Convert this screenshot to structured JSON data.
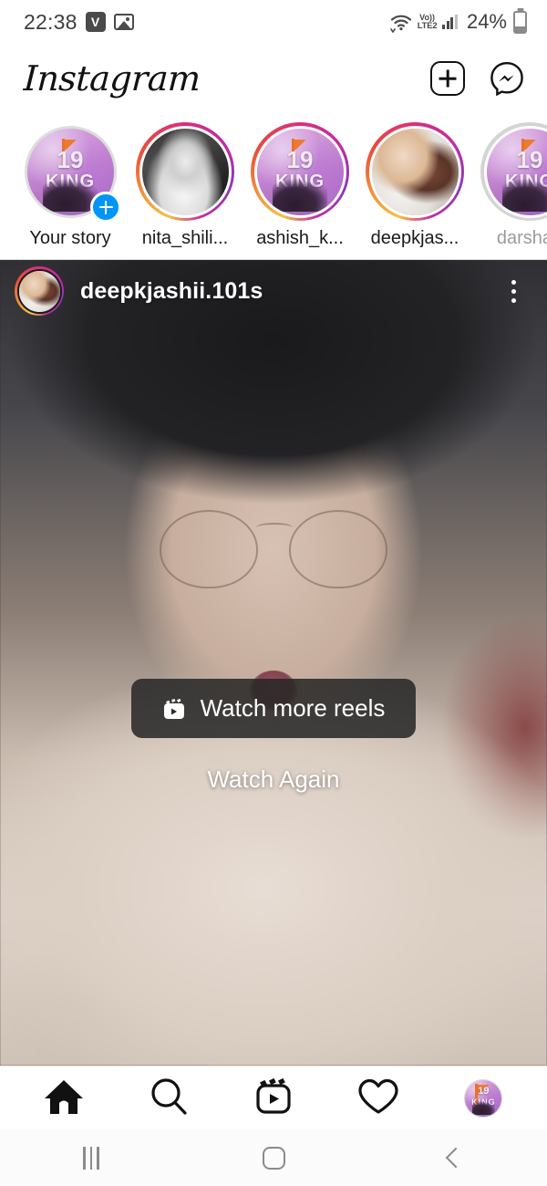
{
  "status_bar": {
    "time": "22:38",
    "app_badge_letter": "V",
    "icons": [
      "v-badge-icon",
      "image-icon",
      "wifi-icon",
      "volte-icon",
      "signal-bars-icon",
      "battery-icon"
    ],
    "network_label_top": "Vo))",
    "network_label_bottom": "LTE2",
    "battery_percent": "24%"
  },
  "header": {
    "logo_text": "Instagram",
    "actions": [
      {
        "name": "new-post-button",
        "icon": "plus-square-icon"
      },
      {
        "name": "messenger-button",
        "icon": "messenger-icon"
      }
    ]
  },
  "stories": [
    {
      "label": "Your story",
      "ring": "none",
      "thumb": "poster",
      "has_add_badge": true,
      "seen": false
    },
    {
      "label": "nita_shili...",
      "ring": "gradient",
      "thumb": "portrait-bw",
      "has_add_badge": false,
      "seen": false
    },
    {
      "label": "ashish_k...",
      "ring": "gradient",
      "thumb": "poster",
      "has_add_badge": false,
      "seen": false
    },
    {
      "label": "deepkjas...",
      "ring": "gradient",
      "thumb": "couple",
      "has_add_badge": false,
      "seen": false
    },
    {
      "label": "darshan",
      "ring": "seen",
      "thumb": "poster",
      "has_add_badge": false,
      "seen": true
    }
  ],
  "post": {
    "username": "deepkjashii.101s",
    "avatar_thumb": "couple",
    "more_menu_icon": "three-dots-vertical-icon",
    "media_type": "video-reel-ended",
    "overlay": {
      "watch_more_reels_label": "Watch more reels",
      "watch_more_reels_icon": "reels-icon",
      "watch_again_label": "Watch Again"
    }
  },
  "bottom_nav": [
    {
      "name": "nav-home",
      "icon": "home-icon",
      "active": true
    },
    {
      "name": "nav-search",
      "icon": "search-icon",
      "active": false
    },
    {
      "name": "nav-reels",
      "icon": "reels-icon",
      "active": false
    },
    {
      "name": "nav-activity",
      "icon": "heart-icon",
      "active": false
    },
    {
      "name": "nav-profile",
      "icon": "profile-avatar-icon",
      "active": false
    }
  ],
  "android_nav": [
    {
      "name": "android-recents-button",
      "icon": "recents-icon"
    },
    {
      "name": "android-home-button",
      "icon": "home-square-icon"
    },
    {
      "name": "android-back-button",
      "icon": "back-chevron-icon"
    }
  ],
  "colors": {
    "accent_blue": "#0095f6",
    "story_gradient_start": "#f5c244",
    "story_gradient_mid": "#d92e7f",
    "story_gradient_end": "#8a3ab9",
    "text_primary": "#1a1a1a",
    "text_muted": "#9b9b9b",
    "overlay_button_bg": "rgba(38,38,38,0.86)"
  }
}
